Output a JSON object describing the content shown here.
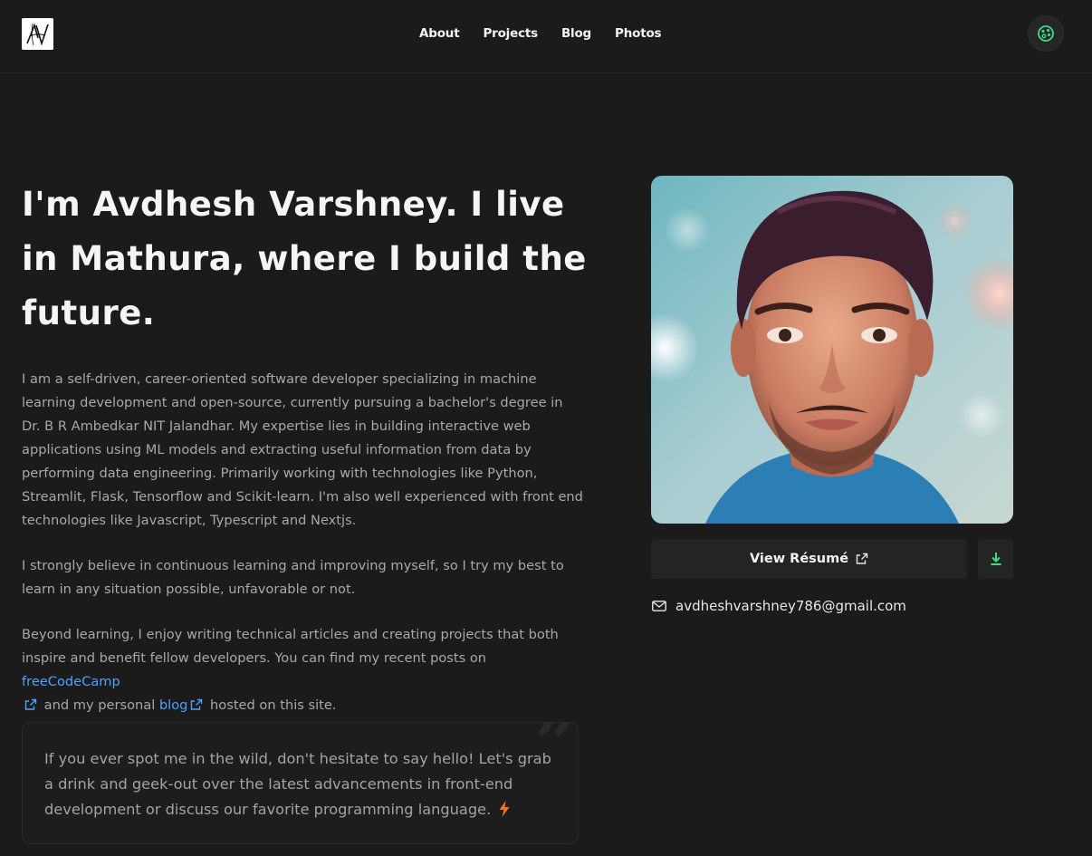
{
  "header": {
    "logo_alt": "AV monogram",
    "nav": [
      "About",
      "Projects",
      "Blog",
      "Photos"
    ],
    "theme_toggle_icon": "palette-icon",
    "accent": "#3ddc84"
  },
  "hero": {
    "title": "I'm Avdhesh Varshney. I live in Mathura, where I build the future.",
    "bio": {
      "p1": "I am a self-driven, career-oriented software developer specializing in machine learning development and open-source, currently pursuing a bachelor's degree in Dr. B R Ambedkar NIT Jalandhar. My expertise lies in building interactive web applications using ML models and extracting useful information from data by performing data engineering. Primarily working with technologies like Python, Streamlit, Flask, Tensorflow and Scikit-learn. I'm also well experienced with front end technologies like Javascript, Typescript and Nextjs.",
      "p2": "I strongly believe in continuous learning and improving myself, so I try my best to learn in any situation possible, unfavorable or not.",
      "p3_before": "Beyond learning, I enjoy writing technical articles and creating projects that both inspire and benefit fellow developers. You can find my recent posts on ",
      "p3_link1": "freeCodeCamp",
      "p3_middle": " and my personal ",
      "p3_link2": "blog",
      "p3_after": " hosted on this site."
    },
    "quote": "If you ever spot me in the wild, don't hesitate to say hello! Let's grab a drink and geek-out over the latest advancements in front-end development or discuss our favorite programming language.",
    "quote_emoji": "⚡"
  },
  "side": {
    "resume_label": "View Résumé",
    "email": "avdheshvarshney786@gmail.com"
  },
  "colors": {
    "background": "#1b1b1b",
    "link": "#4ea1ff",
    "download": "#3ddc84"
  }
}
